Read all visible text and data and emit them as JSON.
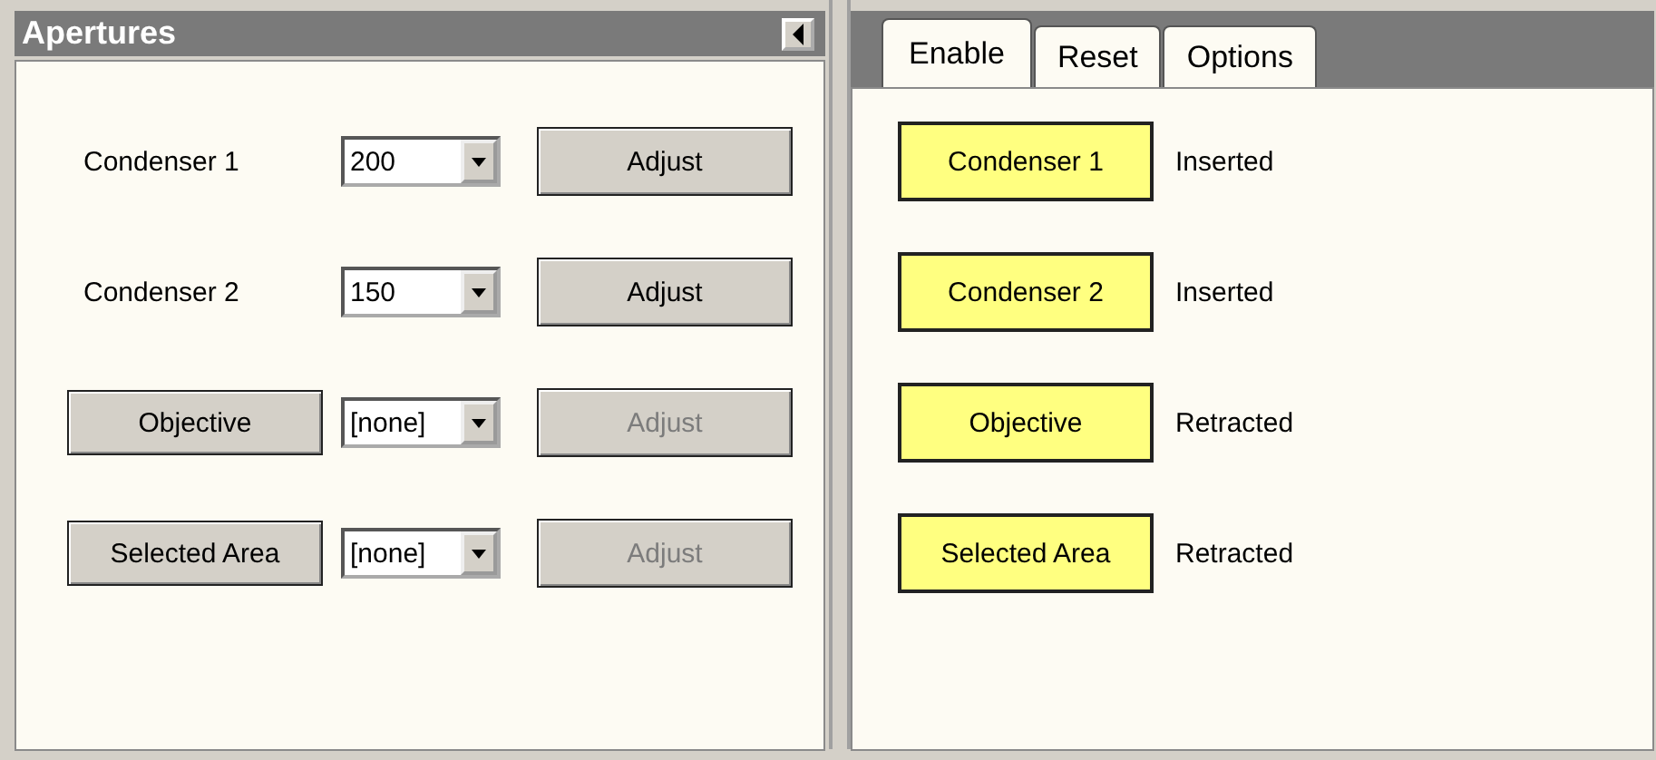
{
  "apertures": {
    "title": "Apertures",
    "rows": [
      {
        "kind": "label",
        "name": "Condenser 1",
        "value": "200",
        "adjust": {
          "label": "Adjust",
          "disabled": false
        }
      },
      {
        "kind": "label",
        "name": "Condenser 2",
        "value": "150",
        "adjust": {
          "label": "Adjust",
          "disabled": false
        }
      },
      {
        "kind": "button",
        "name": "Objective",
        "value": "[none]",
        "adjust": {
          "label": "Adjust",
          "disabled": true
        }
      },
      {
        "kind": "button",
        "name": "Selected Area",
        "value": "[none]",
        "adjust": {
          "label": "Adjust",
          "disabled": true
        }
      }
    ]
  },
  "tabs": [
    {
      "label": "Enable",
      "selected": true
    },
    {
      "label": "Reset",
      "selected": false
    },
    {
      "label": "Options",
      "selected": false
    }
  ],
  "enable_rows": [
    {
      "label": "Condenser 1",
      "status": "Inserted"
    },
    {
      "label": "Condenser 2",
      "status": "Inserted"
    },
    {
      "label": "Objective",
      "status": "Retracted"
    },
    {
      "label": "Selected Area",
      "status": "Retracted"
    }
  ]
}
